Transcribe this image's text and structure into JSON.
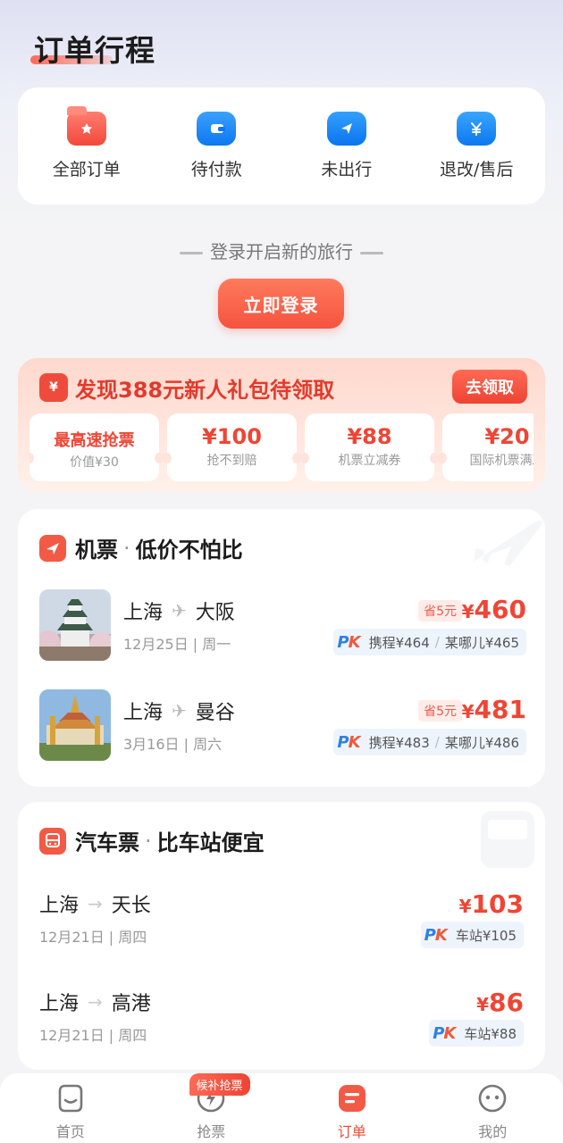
{
  "header": {
    "title": "订单行程"
  },
  "categories": [
    {
      "label": "全部订单",
      "icon": "all-orders-icon"
    },
    {
      "label": "待付款",
      "icon": "wallet-icon"
    },
    {
      "label": "未出行",
      "icon": "send-icon"
    },
    {
      "label": "退改/售后",
      "icon": "yen-icon"
    }
  ],
  "login": {
    "prompt": "登录开启新的旅行",
    "button": "立即登录"
  },
  "gift": {
    "icon_glyph": "¥",
    "title": "发现388元新人礼包待领取",
    "claim": "去领取",
    "coupons": [
      {
        "main": "最高速抢票",
        "sub": "价值¥30"
      },
      {
        "main": "¥100",
        "sub": "抢不到赔"
      },
      {
        "main": "¥88",
        "sub": "机票立减券"
      },
      {
        "main": "¥20",
        "sub": "国际机票满减"
      }
    ]
  },
  "flights": {
    "title": "机票",
    "dot": "·",
    "slogan": "低价不怕比",
    "routes": [
      {
        "from": "上海",
        "to": "大阪",
        "date": "12月25日 | 周一",
        "save": "省5元",
        "price_symbol": "¥",
        "price": "460",
        "pk_logo_p": "P",
        "pk_logo_k": "K",
        "compare1": "携程¥464",
        "compare2": "某哪儿¥465"
      },
      {
        "from": "上海",
        "to": "曼谷",
        "date": "3月16日 | 周六",
        "save": "省5元",
        "price_symbol": "¥",
        "price": "481",
        "pk_logo_p": "P",
        "pk_logo_k": "K",
        "compare1": "携程¥483",
        "compare2": "某哪儿¥486"
      }
    ]
  },
  "bus": {
    "title": "汽车票",
    "dot": "·",
    "slogan": "比车站便宜",
    "routes": [
      {
        "from": "上海",
        "to": "天长",
        "date": "12月21日 | 周四",
        "price_symbol": "¥",
        "price": "103",
        "pk_logo_p": "P",
        "pk_logo_k": "K",
        "compare": "车站¥105"
      },
      {
        "from": "上海",
        "to": "高港",
        "date": "12月21日 | 周四",
        "price_symbol": "¥",
        "price": "86",
        "pk_logo_p": "P",
        "pk_logo_k": "K",
        "compare": "车站¥88"
      }
    ]
  },
  "tabbar": {
    "items": [
      {
        "label": "首页",
        "icon": "home-face-icon"
      },
      {
        "label": "抢票",
        "icon": "lightning-icon",
        "badge": "候补抢票"
      },
      {
        "label": "订单",
        "icon": "order-icon"
      },
      {
        "label": "我的",
        "icon": "profile-face-icon"
      }
    ],
    "active": "订单"
  },
  "colors": {
    "accent": "#ef4535",
    "blue": "#0d77f0"
  }
}
